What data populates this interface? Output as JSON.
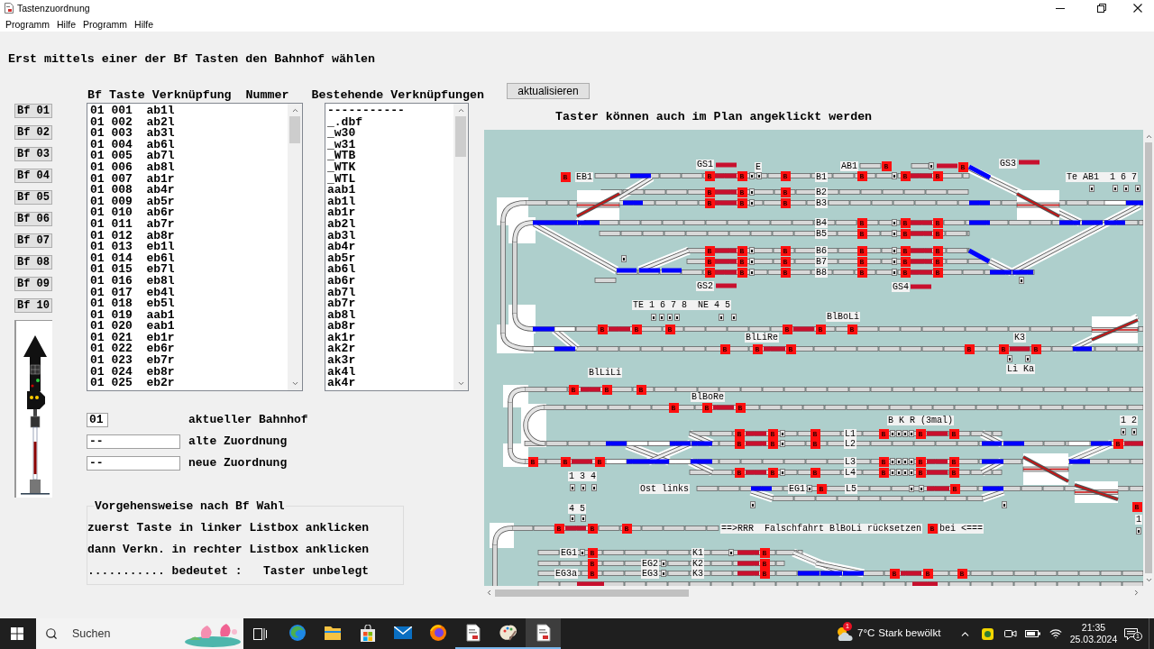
{
  "window": {
    "title": "Tastenzuordnung"
  },
  "menu": [
    "Programm",
    "Hilfe",
    "Programm",
    "Hilfe"
  ],
  "heading": "Erst mittels einer der Bf Tasten den Bahnhof wählen",
  "station_buttons": [
    "Bf 01",
    "Bf 02",
    "Bf 03",
    "Bf 04",
    "Bf 05",
    "Bf 06",
    "Bf 07",
    "Bf 08",
    "Bf 09",
    "Bf 10"
  ],
  "key_list": {
    "header": "Bf Taste Verknüpfung  Nummer",
    "rows": [
      "01 001  ab1l",
      "01 002  ab2l",
      "01 003  ab3l",
      "01 004  ab6l",
      "01 005  ab7l",
      "01 006  ab8l",
      "01 007  ab1r",
      "01 008  ab4r",
      "01 009  ab5r",
      "01 010  ab6r",
      "01 011  ab7r",
      "01 012  ab8r",
      "01 013  eb1l",
      "01 014  eb6l",
      "01 015  eb7l",
      "01 016  eb8l",
      "01 017  eb4l",
      "01 018  eb5l",
      "01 019  aab1",
      "01 020  eab1",
      "01 021  eb1r",
      "01 022  eb6r",
      "01 023  eb7r",
      "01 024  eb8r",
      "01 025  eb2r"
    ]
  },
  "link_list": {
    "header": "Bestehende Verknüpfungen",
    "rows": [
      "-----------",
      "_.dbf",
      "_w30",
      "_w31",
      "_WTB",
      "_WTK",
      "_WTL",
      "aab1",
      "ab1l",
      "ab1r",
      "ab2l",
      "ab3l",
      "ab4r",
      "ab5r",
      "ab6l",
      "ab6r",
      "ab7l",
      "ab7r",
      "ab8l",
      "ab8r",
      "ak1r",
      "ak2r",
      "ak3r",
      "ak4l",
      "ak4r"
    ]
  },
  "refresh_button": "aktualisieren",
  "plan_hint": "Taster können auch im Plan angeklickt werden",
  "fields": [
    {
      "value": "01",
      "label": "aktueller Bahnhof"
    },
    {
      "value": "--",
      "label": "alte Zuordnung"
    },
    {
      "value": "--",
      "label": "neue Zuordnung"
    }
  ],
  "procedure": {
    "title": "Vorgehensweise nach Bf Wahl",
    "lines": [
      "zuerst Taste in linker Listbox anklicken",
      "dann Verkn. in rechter Listbox anklicken",
      "........... bedeutet :   Taster unbelegt"
    ]
  },
  "track_plan": {
    "labels": [
      "GS1",
      "E",
      "AB1",
      "GS3",
      "EB1",
      "B1",
      "Te AB1  1 6 7",
      "B2",
      "B3",
      "B4",
      "B5",
      "B6",
      "B7",
      "B8",
      "GS2",
      "GS4",
      "TE 1 6 7 8  NE 4 5",
      "BlBoLi",
      "BlLiRe",
      "K3",
      "Li Ka",
      "BlLiLi",
      "BlBoRe",
      "B K R (3mal)",
      "1 2",
      "L1",
      "L2",
      "L3",
      "L4",
      "1 3 4",
      "Ost links",
      "EG1",
      "L5",
      "4 5",
      "1",
      "==>RRR  Falschfahrt BlBoLi rücksetzen",
      "bei <===",
      "EG1",
      "K1",
      "EG2",
      "K2",
      "EG3a",
      "EG3",
      "K3"
    ],
    "keys": [
      "B",
      "B",
      "B",
      "B",
      "B",
      "B",
      "B",
      "B",
      "B",
      "B",
      "B",
      "B",
      "B",
      "B",
      "B",
      "B",
      "B",
      "B",
      "B",
      "B",
      "B",
      "B",
      "B",
      "B",
      "B",
      "B",
      "B",
      "B",
      "B",
      "B",
      "B",
      "B",
      "B",
      "B",
      "B",
      "B",
      "B",
      "B",
      "B",
      "B",
      "B",
      "B",
      "B",
      "B",
      "B",
      "B",
      "B",
      "B",
      "B",
      "B",
      "B",
      "B",
      "B",
      "B",
      "B",
      "B",
      "B",
      "B",
      "B",
      "B",
      "B",
      "B",
      "B",
      "B",
      "B",
      "B",
      "B",
      "B",
      "B",
      "B",
      "B",
      "B",
      "B",
      "B",
      "B",
      "B",
      "B",
      "B",
      "B",
      "B",
      "B",
      "B",
      "B",
      "B",
      "B",
      "B",
      "B",
      "B",
      "B",
      "B",
      "B",
      "B",
      "B",
      "B",
      "B"
    ]
  },
  "taskbar": {
    "search": {
      "placeholder": "Suchen"
    },
    "apps": [
      {
        "running": false,
        "selected": false
      },
      {
        "running": false,
        "selected": false
      },
      {
        "running": false,
        "selected": false
      },
      {
        "running": false,
        "selected": false
      },
      {
        "running": false,
        "selected": false
      },
      {
        "running": true,
        "selected": false
      },
      {
        "running": true,
        "selected": false
      },
      {
        "running": true,
        "selected": true
      }
    ],
    "weather": {
      "badge": "1",
      "temperature": "7°C",
      "condition": "Stark bewölkt"
    },
    "time": "21:35",
    "date": "25.03.2024",
    "notification_count": "1"
  }
}
